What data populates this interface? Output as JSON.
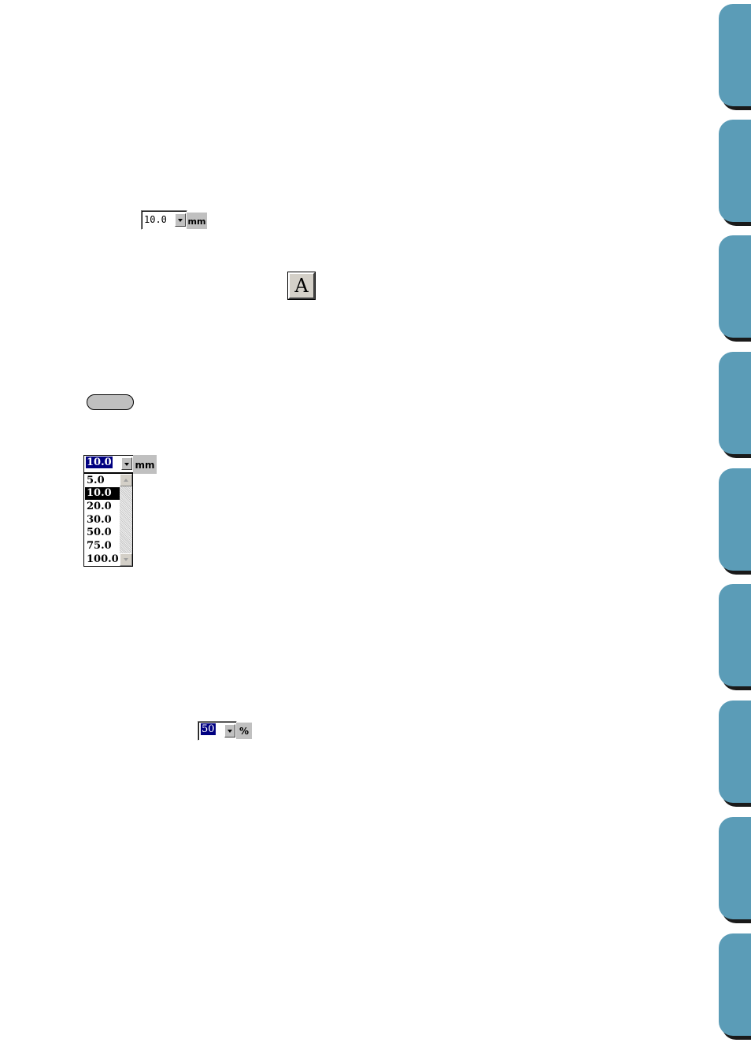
{
  "size_combo_small": {
    "value": "10.0",
    "unit": "mm"
  },
  "tool_button": {
    "label": "A"
  },
  "size_combo_open": {
    "value": "10.0",
    "unit": "mm",
    "options": [
      "5.0",
      "10.0",
      "20.0",
      "30.0",
      "50.0",
      "75.0",
      "100.0"
    ],
    "selected_option": "10.0"
  },
  "percent_combo": {
    "value": "50",
    "unit": "%"
  },
  "colors": {
    "tab": "#5b9cb7",
    "tab_shadow": "#1a1a1a",
    "button_face": "#c0c0c0"
  },
  "side_tabs": {
    "count": 9
  }
}
